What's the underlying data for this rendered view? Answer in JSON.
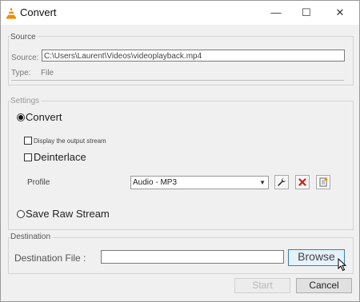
{
  "window": {
    "title": "Convert",
    "minimize_glyph": "—",
    "maximize_glyph": "☐",
    "close_glyph": "✕"
  },
  "source": {
    "group_label": "Source",
    "source_label": "Source:",
    "source_path": "C:\\Users\\Laurent\\Videos\\videoplayback.mp4",
    "type_label": "Type:",
    "type_value": "File"
  },
  "settings": {
    "group_label": "Settings",
    "convert_label": "Convert",
    "display_output_label": "Display the output stream",
    "deinterlace_label": "Deinterlace",
    "profile_label": "Profile",
    "profile_value": "Audio - MP3",
    "save_raw_label": "Save Raw Stream",
    "icons": [
      "wrench-icon",
      "delete-icon",
      "new-profile-icon"
    ]
  },
  "destination": {
    "group_label": "Destination",
    "file_label": "Destination File :",
    "file_value": "",
    "browse_label": "Browse"
  },
  "footer": {
    "start_label": "Start",
    "cancel_label": "Cancel"
  },
  "colors": {
    "accent": "#3c7fb1",
    "delete_red": "#d11a1a",
    "vlc_orange": "#f08c00"
  }
}
